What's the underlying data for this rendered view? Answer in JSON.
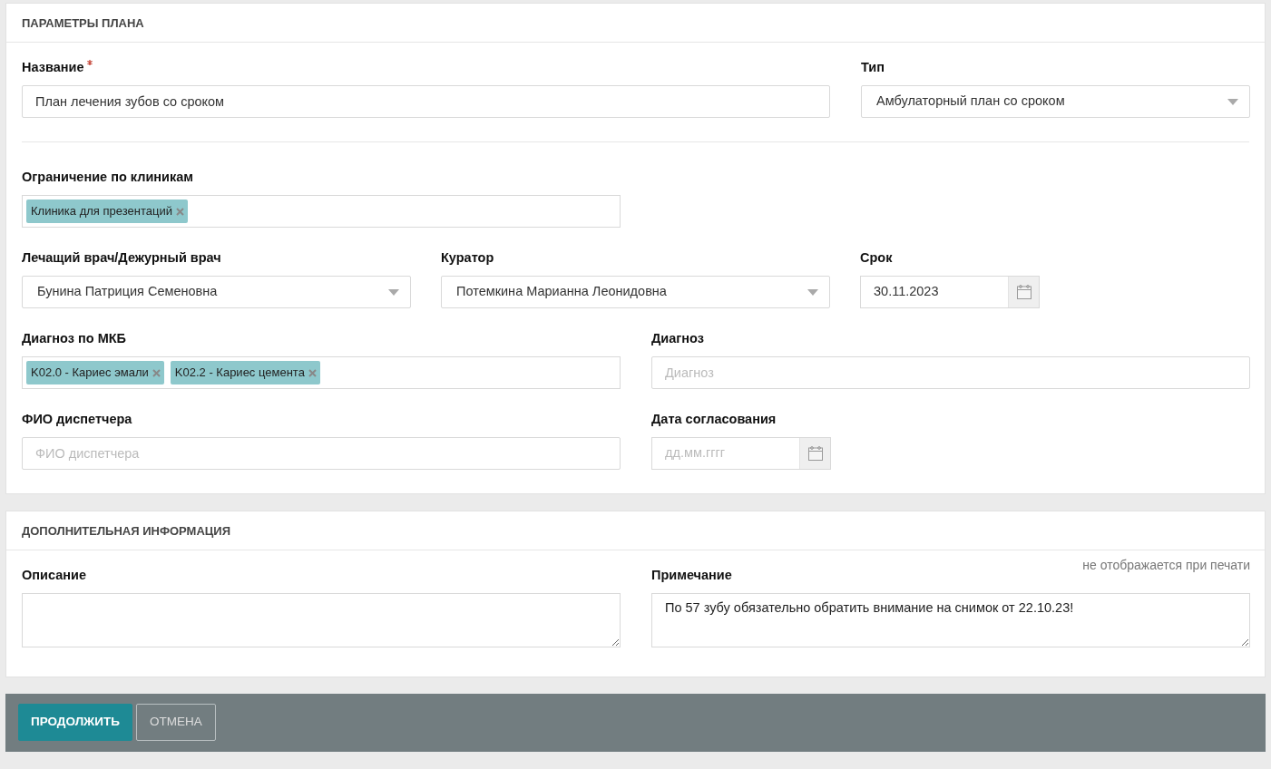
{
  "sections": [
    {
      "title": "ПАРАМЕТРЫ ПЛАНА",
      "fields": [
        {
          "kind": "text",
          "label": "Название",
          "required": true,
          "value": "План лечения зубов со сроком"
        },
        {
          "kind": "select",
          "label": "Тип",
          "value": "Амбулаторный план со сроком"
        },
        {
          "kind": "tags",
          "label": "Ограничение по клиникам",
          "tags": [
            "Клиника для презентаций"
          ]
        },
        {
          "kind": "select",
          "label": "Лечащий врач/Дежурный врач",
          "value": "Бунина Патриция Семеновна"
        },
        {
          "kind": "select",
          "label": "Куратор",
          "value": "Потемкина Марианна Леонидовна"
        },
        {
          "kind": "date",
          "label": "Срок",
          "value": "30.11.2023"
        },
        {
          "kind": "tags",
          "label": "Диагноз по МКБ",
          "tags": [
            "K02.0 - Кариес эмали",
            "K02.2 - Кариес цемента"
          ]
        },
        {
          "kind": "text",
          "label": "Диагноз",
          "placeholder": "Диагноз"
        },
        {
          "kind": "text",
          "label": "ФИО диспетчера",
          "placeholder": "ФИО диспетчера"
        },
        {
          "kind": "date",
          "label": "Дата согласования",
          "placeholder": "дд.мм.гггг"
        }
      ]
    },
    {
      "title": "ДОПОЛНИТЕЛЬНАЯ ИНФОРМАЦИЯ",
      "fields": [
        {
          "kind": "textarea",
          "label": "Описание"
        },
        {
          "kind": "textarea",
          "label": "Примечание",
          "note": "не отображается при печати",
          "value": "По 57 зубу обязательно обратить внимание на снимок от 22.10.23!"
        }
      ]
    }
  ],
  "buttons": [
    {
      "label": "ПРОДОЛЖИТЬ",
      "primary": true
    },
    {
      "label": "ОТМЕНА",
      "primary": false
    }
  ]
}
